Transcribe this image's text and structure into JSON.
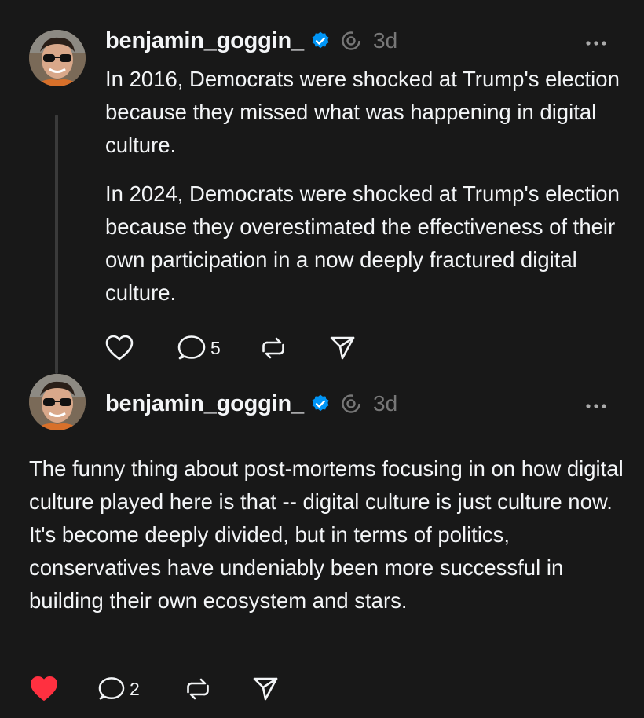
{
  "posts": [
    {
      "username": "benjamin_goggin_",
      "timestamp": "3d",
      "paragraphs": [
        "In 2016, Democrats were shocked at Trump's election because they missed what was happening in digital culture.",
        "In 2024, Democrats were shocked at Trump's election because they overestimated the effectiveness of their own participation in a now deeply fractured digital culture."
      ],
      "reply_count": "5",
      "liked": false
    },
    {
      "username": "benjamin_goggin_",
      "timestamp": "3d",
      "paragraphs": [
        "The funny thing about post-mortems focusing in on how digital culture played here is that -- digital culture is just culture now. It's become deeply divided, but in terms of politics, conservatives have undeniably been more successful in building their own ecosystem and stars."
      ],
      "reply_count": "2",
      "liked": true
    }
  ],
  "icons": {
    "like": "heart-icon",
    "reply": "speech-bubble-icon",
    "repost": "repost-icon",
    "share": "paper-plane-icon",
    "more": "ellipsis-icon",
    "verified": "verified-badge-icon",
    "threads": "threads-logo-icon"
  },
  "colors": {
    "background": "#181818",
    "text": "#f3f5f7",
    "secondary": "#777777",
    "verified": "#0095f6",
    "liked": "#ff3040",
    "thread_line": "#3a3a3a"
  }
}
